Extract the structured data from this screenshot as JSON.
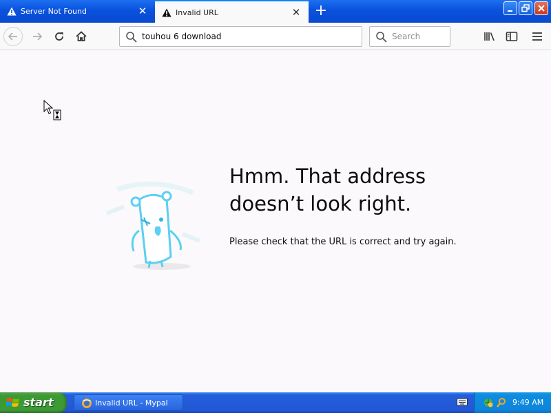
{
  "tabs": [
    {
      "label": "Server Not Found",
      "icon": "warning-icon",
      "active": false
    },
    {
      "label": "Invalid URL",
      "icon": "warning-icon",
      "active": true
    }
  ],
  "toolbar": {
    "url": "touhou 6 download",
    "search_placeholder": "Search"
  },
  "error_page": {
    "heading": "Hmm. That address doesn’t look right.",
    "description": "Please check that the URL is correct and try again."
  },
  "taskbar": {
    "start_label": "start",
    "task_label": "Invalid URL - Mypal",
    "clock": "9:49 AM"
  },
  "colors": {
    "xp_blue": "#245edb",
    "start_green": "#3c9a34",
    "page_bg": "#fbf9fb",
    "mascot": "#5bd0f0"
  }
}
